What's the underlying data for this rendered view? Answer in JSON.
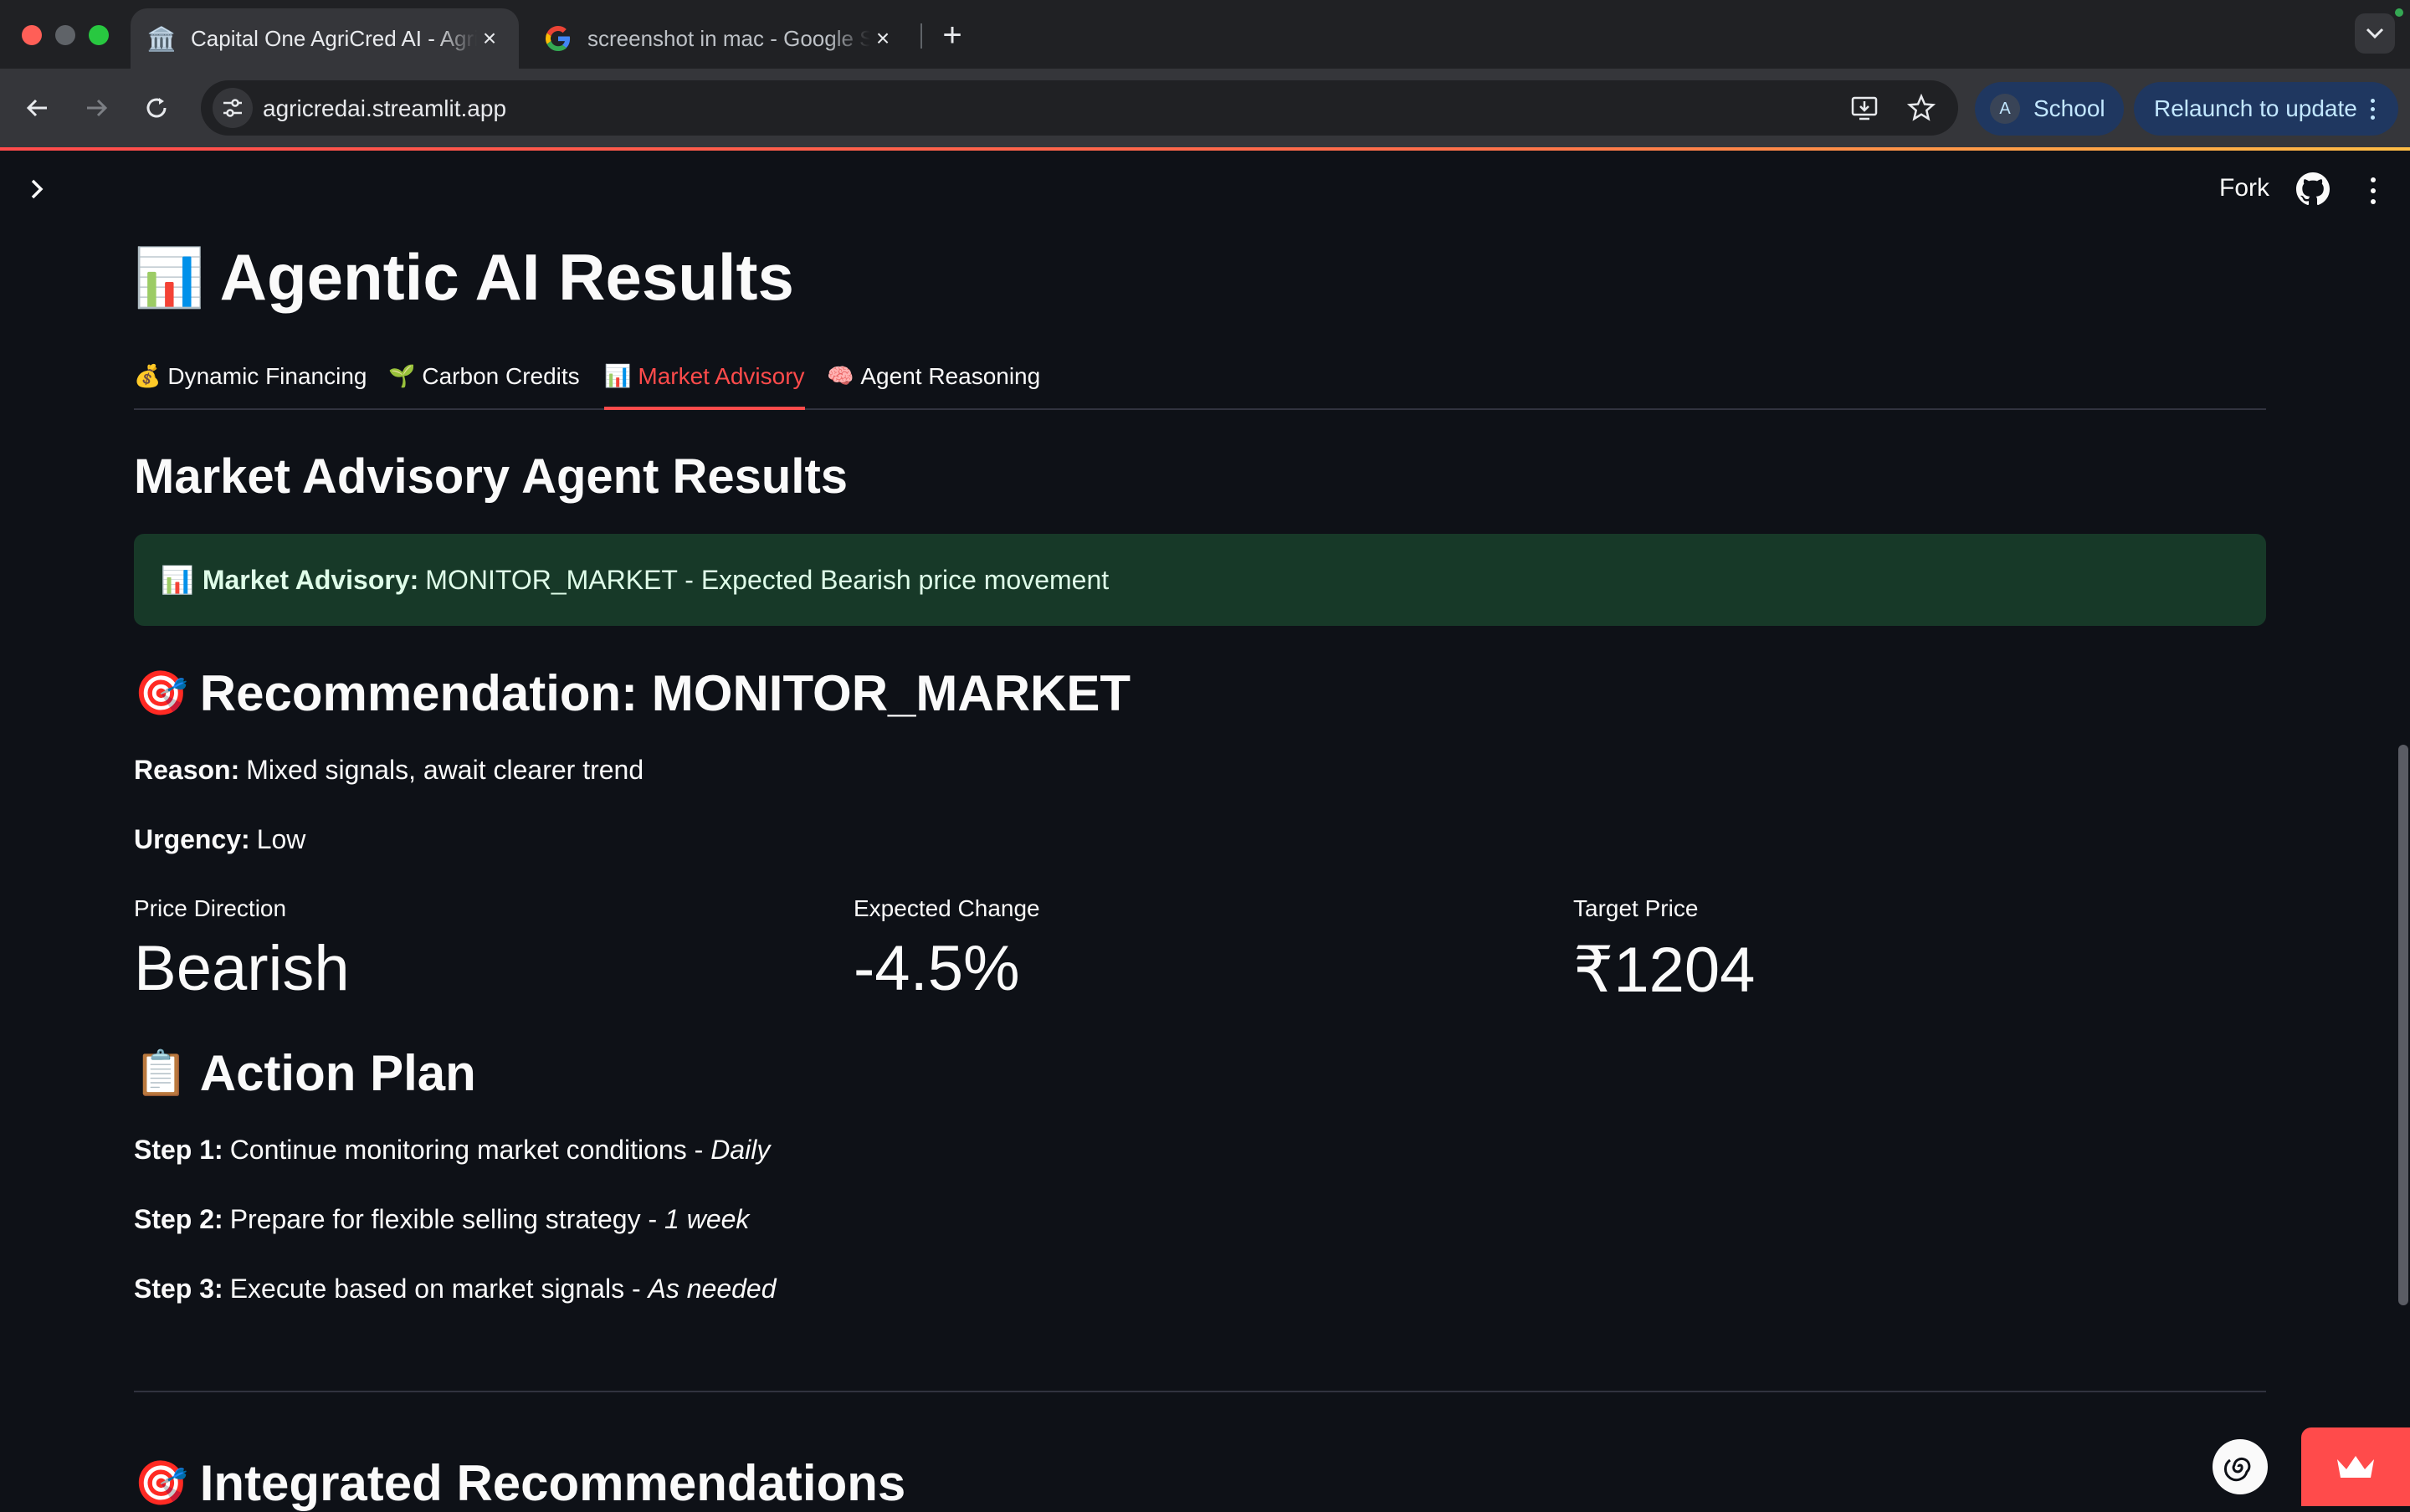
{
  "browser": {
    "tabs": [
      {
        "title": "Capital One AgriCred AI - AgriCred",
        "favicon": "bank-emoji",
        "active": true
      },
      {
        "title": "screenshot in mac - Google Search",
        "favicon": "google-icon",
        "active": false
      }
    ],
    "url": "agricredai.streamlit.app",
    "profile": {
      "initial": "A",
      "name": "School"
    },
    "relaunch_label": "Relaunch to update",
    "colors": {
      "tabstrip": "#202124",
      "toolbar": "#35363a",
      "accent_pill": "#1f3760"
    }
  },
  "app_header": {
    "fork_label": "Fork",
    "icons": [
      "chevron-right-icon",
      "github-icon",
      "kebab-menu-icon"
    ]
  },
  "page": {
    "title_emoji": "📊",
    "title": "Agentic AI Results",
    "tabs": [
      {
        "emoji": "💰",
        "label": "Dynamic Financing"
      },
      {
        "emoji": "🌱",
        "label": "Carbon Credits"
      },
      {
        "emoji": "📊",
        "label": "Market Advisory"
      },
      {
        "emoji": "🧠",
        "label": "Agent Reasoning"
      }
    ],
    "active_tab": "Market Advisory",
    "section_title": "Market Advisory Agent Results",
    "alert": {
      "emoji": "📊",
      "label": "Market Advisory:",
      "text": "MONITOR_MARKET - Expected Bearish price movement"
    },
    "recommendation": {
      "emoji": "🎯",
      "heading": "Recommendation: MONITOR_MARKET",
      "reason_label": "Reason:",
      "reason": "Mixed signals, await clearer trend",
      "urgency_label": "Urgency:",
      "urgency": "Low"
    },
    "metrics": [
      {
        "label": "Price Direction",
        "value": "Bearish"
      },
      {
        "label": "Expected Change",
        "value": "-4.5%"
      },
      {
        "label": "Target Price",
        "value": "₹1204"
      }
    ],
    "action_plan": {
      "emoji": "📋",
      "heading": "Action Plan",
      "steps": [
        {
          "label": "Step 1:",
          "text": "Continue monitoring market conditions -",
          "timing": "Daily"
        },
        {
          "label": "Step 2:",
          "text": "Prepare for flexible selling strategy -",
          "timing": "1 week"
        },
        {
          "label": "Step 3:",
          "text": "Execute based on market signals -",
          "timing": "As needed"
        }
      ]
    },
    "integrated": {
      "emoji": "🎯",
      "heading": "Integrated Recommendations"
    }
  },
  "colors": {
    "background": "#0e1117",
    "accent": "#ff4b4b",
    "success_bg": "#173928",
    "text": "#fafafa"
  }
}
